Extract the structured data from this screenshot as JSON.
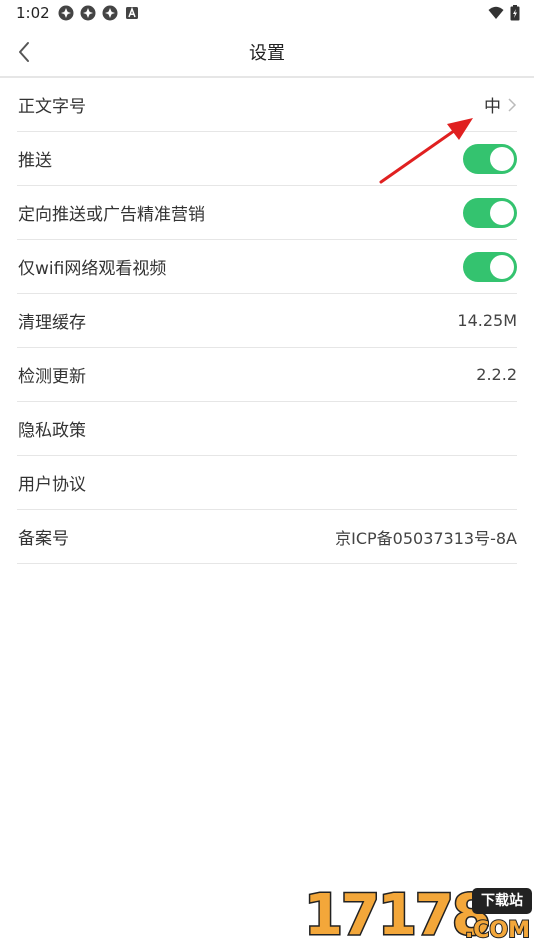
{
  "status_bar": {
    "time": "1:02",
    "left_icons": [
      "app-notification-icon",
      "app-notification-icon",
      "app-notification-icon",
      "a-notification-icon"
    ],
    "right_icons": [
      "wifi-icon",
      "battery-charging-icon"
    ]
  },
  "header": {
    "title": "设置",
    "back_icon": "chevron-left-icon"
  },
  "settings": {
    "font_size": {
      "label": "正文字号",
      "value": "中"
    },
    "push": {
      "label": "推送",
      "enabled": true
    },
    "targeted_ads": {
      "label": "定向推送或广告精准营销",
      "enabled": true
    },
    "wifi_only_video": {
      "label": "仅wifi网络观看视频",
      "enabled": true
    },
    "clear_cache": {
      "label": "清理缓存",
      "value": "14.25M"
    },
    "check_update": {
      "label": "检测更新",
      "value": "2.2.2"
    },
    "privacy_policy": {
      "label": "隐私政策"
    },
    "user_agreement": {
      "label": "用户协议"
    },
    "icp": {
      "label": "备案号",
      "value": "京ICP备05037313号-8A"
    }
  },
  "colors": {
    "toggle_on": "#34c36f",
    "divider": "#e6e6e6",
    "annotation_arrow": "#e02020",
    "watermark_orange": "#f3a73a"
  },
  "watermark": {
    "digits": "17178",
    "badge": "下载站",
    "domain": ".COM"
  }
}
